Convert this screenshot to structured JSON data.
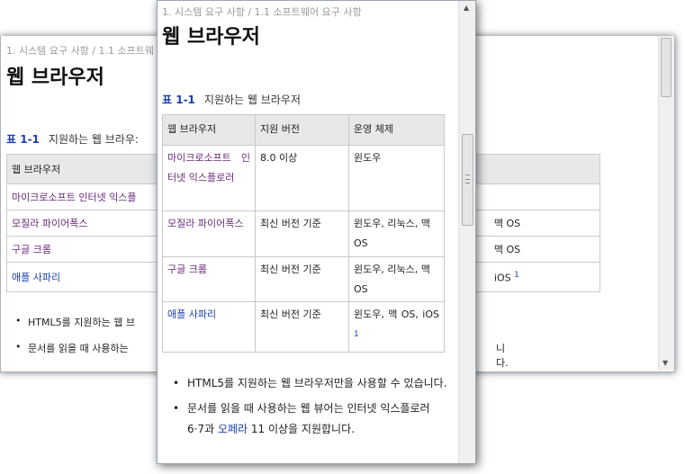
{
  "breadcrumb": "1. 시스템 요구 사항 / 1.1 소프트웨어 요구 사항",
  "breadcrumb_back_visible": "1. 시스템 요구 사항 / 1.1 소프트웨",
  "heading": "웹 브라우저",
  "table_caption": {
    "label": "표 1-1",
    "text": "지원하는 웹 브라우저"
  },
  "table_caption_back_text": "지원하는 웹 브라우:",
  "table": {
    "headers": [
      "웹 브라우저",
      "지원 버전",
      "운영 체제"
    ],
    "rows": [
      {
        "browser": "마이크로소프트 인터넷 익스플로러",
        "version": "8.0 이상",
        "os": "윈도우",
        "footnote": ""
      },
      {
        "browser": "모질라 파이어폭스",
        "version": "최신 버전 기준",
        "os": "윈도우, 리눅스, 맥 OS",
        "footnote": ""
      },
      {
        "browser": "구글 크롬",
        "version": "최신 버전 기준",
        "os": "윈도우, 리눅스, 맥 OS",
        "footnote": ""
      },
      {
        "browser": "애플 사파리",
        "version": "최신 버전 기준",
        "os": "윈도우, 맥 OS, iOS",
        "footnote": "1"
      }
    ]
  },
  "back_table": {
    "rows": [
      {
        "browser": "마이크로소프트 인터넷 익스플",
        "os_tail": ""
      },
      {
        "browser": "모질라 파이어폭스",
        "os_tail": "맥 OS"
      },
      {
        "browser": "구글 크롬",
        "os_tail": "맥 OS"
      },
      {
        "browser": "애플 사파리",
        "os_tail": "iOS",
        "footnote": "1"
      }
    ]
  },
  "notes": {
    "item1": "HTML5를 지원하는 웹 브라우저만을 사용할 수 있습니다.",
    "item2_pre": "문서를 읽을 때 사용하는 웹 뷰어는 인터넷 익스플로러 6·7과 ",
    "item2_link": "오페라",
    "item2_post": " 11 이상을 지원합니다."
  },
  "back_notes": {
    "item1": "HTML5를 지원하는 웹 브",
    "item2": "문서를 읽을 때 사용하는",
    "item2_tail": "니다."
  },
  "colors": {
    "link_visited": "#6a2a7a",
    "link": "#1a3fb0",
    "header_bg": "#e8e8e8"
  }
}
